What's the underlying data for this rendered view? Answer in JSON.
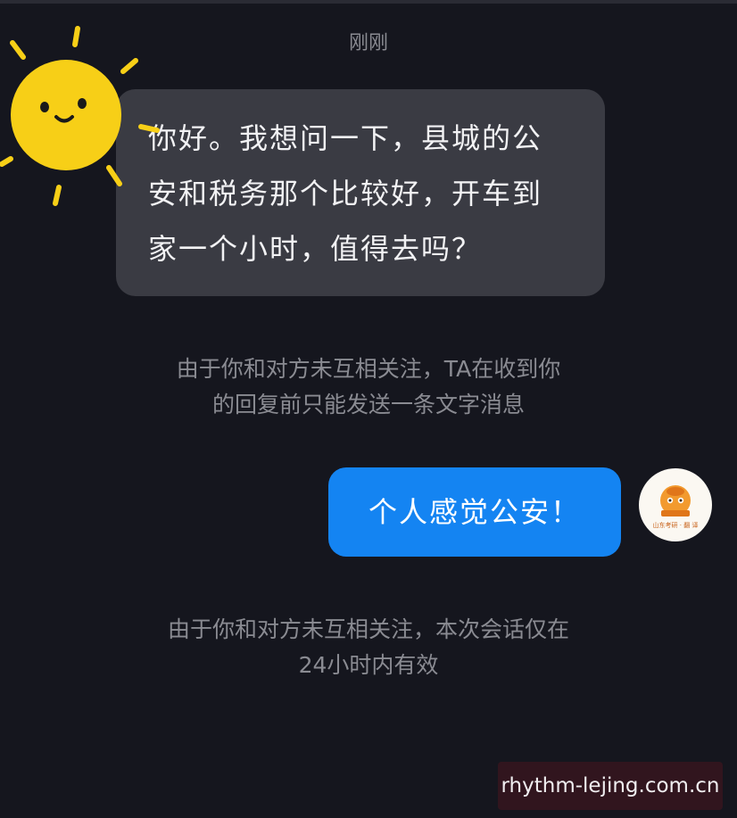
{
  "chat": {
    "timestamp": "刚刚",
    "incoming_message": {
      "lines": [
        "你好。我想问一下，县城的公",
        "安和税务那个比较好，开车到",
        "家一个小时，值得去吗？"
      ]
    },
    "notice_1": {
      "lines": [
        "由于你和对方未互相关注，TA在收到你",
        "的回复前只能发送一条文字消息"
      ]
    },
    "outgoing_message": {
      "text": "个人感觉公安！"
    },
    "notice_2": {
      "lines": [
        "由于你和对方未互相关注，本次会话仅在",
        "24小时内有效"
      ]
    }
  },
  "avatars": {
    "contact_icon": "sun-icon",
    "self_icon": "cartoon-logo-icon",
    "self_logo_text": "山东考研 · 翻 译"
  },
  "watermark": {
    "text": "rhythm-lejing.com.cn"
  },
  "colors": {
    "background": "#15161e",
    "incoming_bubble": "#3a3b43",
    "outgoing_bubble": "#1484f2",
    "sun": "#f7cf17",
    "notice_text": "#8a8b92"
  }
}
